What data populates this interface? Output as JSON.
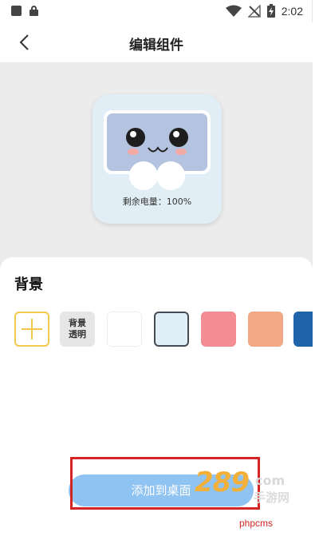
{
  "status_bar": {
    "time": "2:02",
    "icons": [
      "square-icon",
      "lock-icon",
      "wifi-icon",
      "no-signal-icon",
      "battery-charging-icon"
    ]
  },
  "header": {
    "title": "编辑组件",
    "back_icon": "chevron-left-icon"
  },
  "widget_preview": {
    "battery_text": "剩余电量：100%"
  },
  "background_section": {
    "title": "背景",
    "swatches": [
      {
        "kind": "add",
        "icon": "plus-icon",
        "color": "#f2c94c"
      },
      {
        "kind": "transparent",
        "label": "背景\n透明",
        "color": "#e6e6e6"
      },
      {
        "kind": "color",
        "color": "#ffffff"
      },
      {
        "kind": "color",
        "color": "#dfeef7",
        "selected": true
      },
      {
        "kind": "color",
        "color": "#f38d94"
      },
      {
        "kind": "color",
        "color": "#f2a886"
      },
      {
        "kind": "color",
        "color": "#1f63ab"
      }
    ]
  },
  "bottom": {
    "add_button_label": "添加到桌面",
    "accent": "#8ec3f2"
  },
  "watermark": {
    "logo_big": "289",
    "logo_com": "com",
    "logo_cn": "手游网",
    "site": "phpcms"
  }
}
